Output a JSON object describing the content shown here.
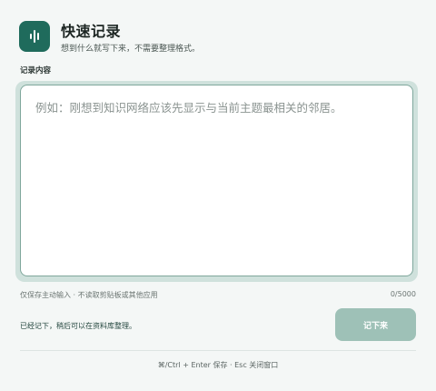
{
  "header": {
    "title": "快速记录",
    "subtitle": "想到什么就写下来，不需要整理格式。",
    "icon": "waveform-icon"
  },
  "note_field": {
    "label": "记录内容",
    "placeholder": "例如：刚想到知识网络应该先显示与当前主题最相关的邻居。",
    "value": ""
  },
  "footer": {
    "helper": "仅保存主动输入 · 不读取剪贴板或其他应用",
    "counter": "0/5000",
    "status": "已经记下，稍后可以在资料库整理。",
    "submit_label": "记下来",
    "shortcut_hint": "⌘/Ctrl + Enter 保存 · Esc 关闭窗口"
  },
  "colors": {
    "accent": "#1f6b5c",
    "button_disabled": "#9ec1b7",
    "focus_ring": "#cfe1dc"
  }
}
